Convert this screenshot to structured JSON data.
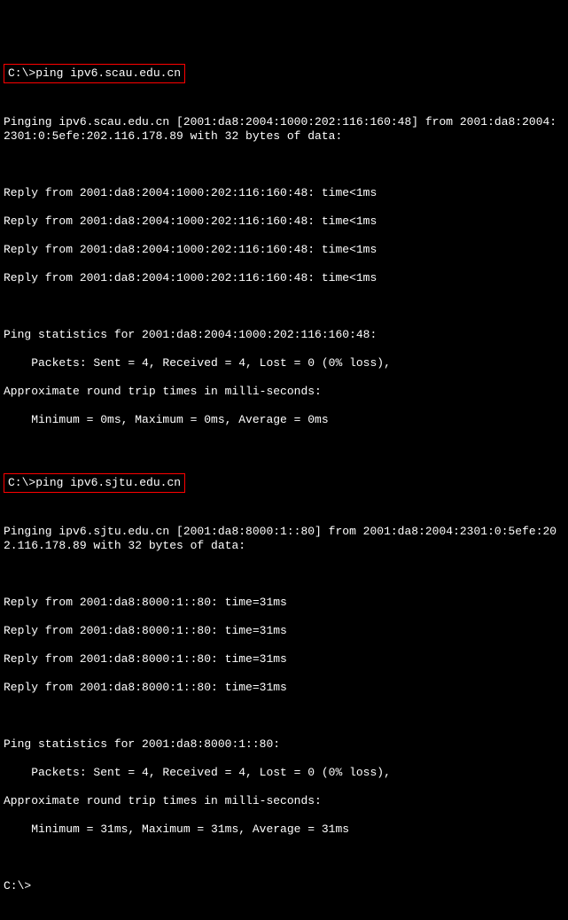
{
  "cmd1": {
    "prompt": "C:\\>",
    "command": "ping ipv6.scau.edu.cn"
  },
  "ping1": {
    "header": "Pinging ipv6.scau.edu.cn [2001:da8:2004:1000:202:116:160:48] from 2001:da8:2004:\n2301:0:5efe:202.116.178.89 with 32 bytes of data:",
    "reply1": "Reply from 2001:da8:2004:1000:202:116:160:48: time<1ms",
    "reply2": "Reply from 2001:da8:2004:1000:202:116:160:48: time<1ms",
    "reply3": "Reply from 2001:da8:2004:1000:202:116:160:48: time<1ms",
    "reply4": "Reply from 2001:da8:2004:1000:202:116:160:48: time<1ms",
    "stats_header": "Ping statistics for 2001:da8:2004:1000:202:116:160:48:",
    "packets": "    Packets: Sent = 4, Received = 4, Lost = 0 (0% loss),",
    "approx": "Approximate round trip times in milli-seconds:",
    "times": "    Minimum = 0ms, Maximum = 0ms, Average = 0ms"
  },
  "cmd2": {
    "prompt": "C:\\>",
    "command": "ping ipv6.sjtu.edu.cn"
  },
  "ping2": {
    "header": "Pinging ipv6.sjtu.edu.cn [2001:da8:8000:1::80] from 2001:da8:2004:2301:0:5efe:20\n2.116.178.89 with 32 bytes of data:",
    "reply1": "Reply from 2001:da8:8000:1::80: time=31ms",
    "reply2": "Reply from 2001:da8:8000:1::80: time=31ms",
    "reply3": "Reply from 2001:da8:8000:1::80: time=31ms",
    "reply4": "Reply from 2001:da8:8000:1::80: time=31ms",
    "stats_header": "Ping statistics for 2001:da8:8000:1::80:",
    "packets": "    Packets: Sent = 4, Received = 4, Lost = 0 (0% loss),",
    "approx": "Approximate round trip times in milli-seconds:",
    "times": "    Minimum = 31ms, Maximum = 31ms, Average = 31ms"
  },
  "cmd3": {
    "prompt": "C:\\>"
  },
  "highlight_color": "#ff0000"
}
